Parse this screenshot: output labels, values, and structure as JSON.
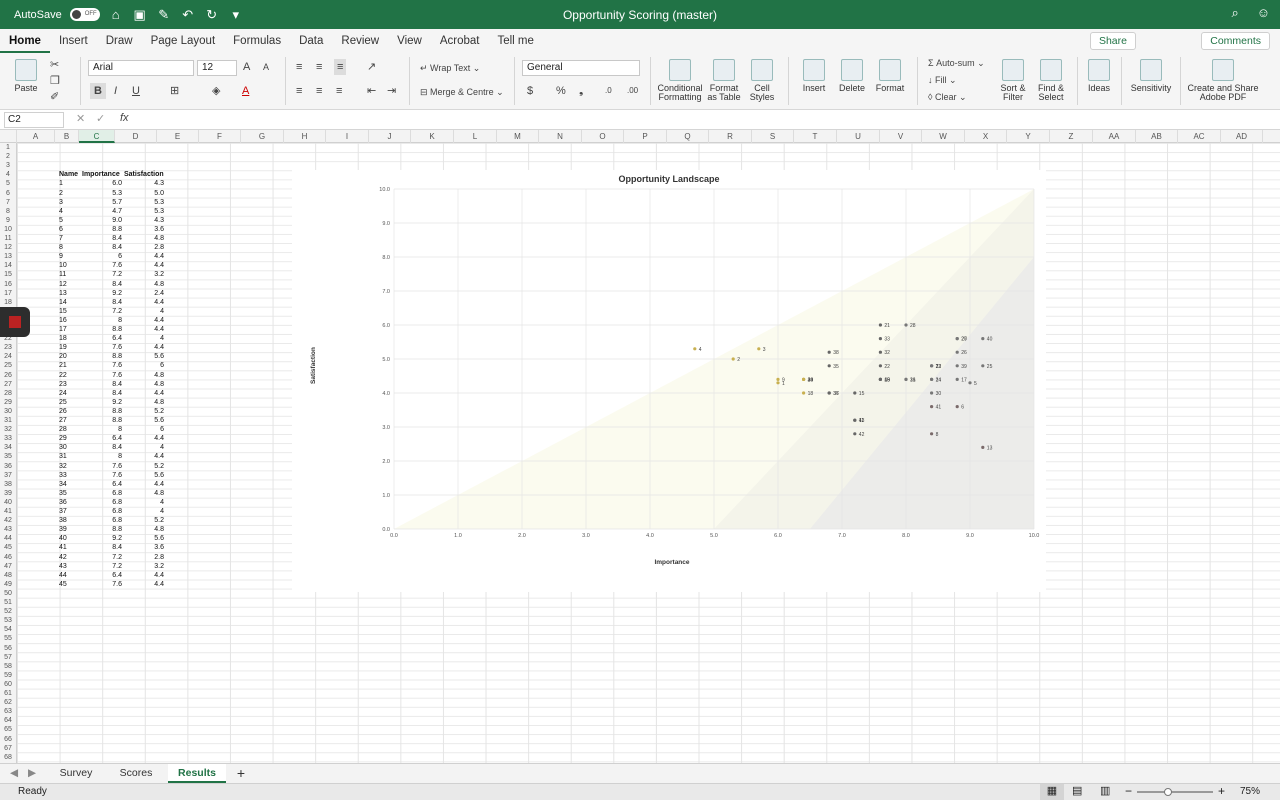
{
  "title_bar": {
    "autosave_label": "AutoSave",
    "autosave_state": "OFF",
    "doc_title": "Opportunity Scoring (master)"
  },
  "ribbon_tabs": [
    "Home",
    "Insert",
    "Draw",
    "Page Layout",
    "Formulas",
    "Data",
    "Review",
    "View",
    "Acrobat",
    "Tell me"
  ],
  "share_label": "Share",
  "comments_label": "Comments",
  "ribbon": {
    "paste": "Paste",
    "font_name": "Arial",
    "font_size": "12",
    "wrap_text": "Wrap Text",
    "merge_centre": "Merge & Centre",
    "number_format": "General",
    "conditional": [
      "Conditional",
      "Formatting"
    ],
    "format_table": [
      "Format",
      "as Table"
    ],
    "cell_styles": [
      "Cell",
      "Styles"
    ],
    "insert": "Insert",
    "delete": "Delete",
    "format": "Format",
    "autosum": "Auto-sum",
    "fill": "Fill",
    "clear": "Clear",
    "sort_filter": [
      "Sort &",
      "Filter"
    ],
    "find_select": [
      "Find &",
      "Select"
    ],
    "ideas": "Ideas",
    "sensitivity": "Sensitivity",
    "adobe": [
      "Create and Share",
      "Adobe PDF"
    ]
  },
  "formula_bar": {
    "name_box": "C2",
    "fx": "fx",
    "formula": ""
  },
  "columns": [
    "A",
    "B",
    "C",
    "D",
    "E",
    "F",
    "G",
    "H",
    "I",
    "J",
    "K",
    "L",
    "M",
    "N",
    "O",
    "P",
    "Q",
    "R",
    "S",
    "T",
    "U",
    "V",
    "W",
    "X",
    "Y",
    "Z",
    "AA",
    "AB",
    "AC",
    "AD"
  ],
  "table": {
    "headers": [
      "Name",
      "Importance",
      "Satisfaction"
    ],
    "rows": [
      [
        "1",
        "6.0",
        "4.3"
      ],
      [
        "2",
        "5.3",
        "5.0"
      ],
      [
        "3",
        "5.7",
        "5.3"
      ],
      [
        "4",
        "4.7",
        "5.3"
      ],
      [
        "5",
        "9.0",
        "4.3"
      ],
      [
        "6",
        "8.8",
        "3.6"
      ],
      [
        "7",
        "8.4",
        "4.8"
      ],
      [
        "8",
        "8.4",
        "2.8"
      ],
      [
        "9",
        "6",
        "4.4"
      ],
      [
        "10",
        "7.6",
        "4.4"
      ],
      [
        "11",
        "7.2",
        "3.2"
      ],
      [
        "12",
        "8.4",
        "4.8"
      ],
      [
        "13",
        "9.2",
        "2.4"
      ],
      [
        "14",
        "8.4",
        "4.4"
      ],
      [
        "15",
        "7.2",
        "4"
      ],
      [
        "16",
        "8",
        "4.4"
      ],
      [
        "17",
        "8.8",
        "4.4"
      ],
      [
        "18",
        "6.4",
        "4"
      ],
      [
        "19",
        "7.6",
        "4.4"
      ],
      [
        "20",
        "8.8",
        "5.6"
      ],
      [
        "21",
        "7.6",
        "6"
      ],
      [
        "22",
        "7.6",
        "4.8"
      ],
      [
        "23",
        "8.4",
        "4.8"
      ],
      [
        "24",
        "8.4",
        "4.4"
      ],
      [
        "25",
        "9.2",
        "4.8"
      ],
      [
        "26",
        "8.8",
        "5.2"
      ],
      [
        "27",
        "8.8",
        "5.6"
      ],
      [
        "28",
        "8",
        "6"
      ],
      [
        "29",
        "6.4",
        "4.4"
      ],
      [
        "30",
        "8.4",
        "4"
      ],
      [
        "31",
        "8",
        "4.4"
      ],
      [
        "32",
        "7.6",
        "5.2"
      ],
      [
        "33",
        "7.6",
        "5.6"
      ],
      [
        "34",
        "6.4",
        "4.4"
      ],
      [
        "35",
        "6.8",
        "4.8"
      ],
      [
        "36",
        "6.8",
        "4"
      ],
      [
        "37",
        "6.8",
        "4"
      ],
      [
        "38",
        "6.8",
        "5.2"
      ],
      [
        "39",
        "8.8",
        "4.8"
      ],
      [
        "40",
        "9.2",
        "5.6"
      ],
      [
        "41",
        "8.4",
        "3.6"
      ],
      [
        "42",
        "7.2",
        "2.8"
      ],
      [
        "43",
        "7.2",
        "3.2"
      ],
      [
        "44",
        "6.4",
        "4.4"
      ],
      [
        "45",
        "7.6",
        "4.4"
      ]
    ]
  },
  "chart_data": {
    "type": "scatter",
    "title": "Opportunity Landscape",
    "xlabel": "Importance",
    "ylabel": "Satisfaction",
    "xlim": [
      0,
      10
    ],
    "ylim": [
      0,
      10
    ],
    "xticks": [
      "0.0",
      "1.0",
      "2.0",
      "3.0",
      "4.0",
      "5.0",
      "6.0",
      "7.0",
      "8.0",
      "9.0",
      "10.0"
    ],
    "yticks": [
      "0.0",
      "1.0",
      "2.0",
      "3.0",
      "4.0",
      "5.0",
      "6.0",
      "7.0",
      "8.0",
      "9.0",
      "10.0"
    ],
    "points": [
      {
        "label": "1",
        "x": 6.0,
        "y": 4.3
      },
      {
        "label": "2",
        "x": 5.3,
        "y": 5.0
      },
      {
        "label": "3",
        "x": 5.7,
        "y": 5.3
      },
      {
        "label": "4",
        "x": 4.7,
        "y": 5.3
      },
      {
        "label": "5",
        "x": 9.0,
        "y": 4.3
      },
      {
        "label": "6",
        "x": 8.8,
        "y": 3.6
      },
      {
        "label": "7",
        "x": 8.4,
        "y": 4.8
      },
      {
        "label": "8",
        "x": 8.4,
        "y": 2.8
      },
      {
        "label": "9",
        "x": 6,
        "y": 4.4
      },
      {
        "label": "10",
        "x": 7.6,
        "y": 4.4
      },
      {
        "label": "11",
        "x": 7.2,
        "y": 3.2
      },
      {
        "label": "12",
        "x": 8.4,
        "y": 4.8
      },
      {
        "label": "13",
        "x": 9.2,
        "y": 2.4
      },
      {
        "label": "14",
        "x": 8.4,
        "y": 4.4
      },
      {
        "label": "15",
        "x": 7.2,
        "y": 4
      },
      {
        "label": "16",
        "x": 8,
        "y": 4.4
      },
      {
        "label": "17",
        "x": 8.8,
        "y": 4.4
      },
      {
        "label": "18",
        "x": 6.4,
        "y": 4
      },
      {
        "label": "19",
        "x": 7.6,
        "y": 4.4
      },
      {
        "label": "20",
        "x": 8.8,
        "y": 5.6
      },
      {
        "label": "21",
        "x": 7.6,
        "y": 6
      },
      {
        "label": "22",
        "x": 7.6,
        "y": 4.8
      },
      {
        "label": "23",
        "x": 8.4,
        "y": 4.8
      },
      {
        "label": "24",
        "x": 8.4,
        "y": 4.4
      },
      {
        "label": "25",
        "x": 9.2,
        "y": 4.8
      },
      {
        "label": "26",
        "x": 8.8,
        "y": 5.2
      },
      {
        "label": "27",
        "x": 8.8,
        "y": 5.6
      },
      {
        "label": "28",
        "x": 8,
        "y": 6
      },
      {
        "label": "29",
        "x": 6.4,
        "y": 4.4
      },
      {
        "label": "30",
        "x": 8.4,
        "y": 4
      },
      {
        "label": "31",
        "x": 8,
        "y": 4.4
      },
      {
        "label": "32",
        "x": 7.6,
        "y": 5.2
      },
      {
        "label": "33",
        "x": 7.6,
        "y": 5.6
      },
      {
        "label": "34",
        "x": 6.4,
        "y": 4.4
      },
      {
        "label": "35",
        "x": 6.8,
        "y": 4.8
      },
      {
        "label": "36",
        "x": 6.8,
        "y": 4
      },
      {
        "label": "37",
        "x": 6.8,
        "y": 4
      },
      {
        "label": "38",
        "x": 6.8,
        "y": 5.2
      },
      {
        "label": "39",
        "x": 8.8,
        "y": 4.8
      },
      {
        "label": "40",
        "x": 9.2,
        "y": 5.6
      },
      {
        "label": "41",
        "x": 8.4,
        "y": 3.6
      },
      {
        "label": "42",
        "x": 7.2,
        "y": 2.8
      },
      {
        "label": "43",
        "x": 7.2,
        "y": 3.2
      },
      {
        "label": "44",
        "x": 6.4,
        "y": 4.4
      },
      {
        "label": "45",
        "x": 7.6,
        "y": 4.4
      }
    ],
    "grid": true,
    "legend": "none"
  },
  "sheet_tabs": [
    "Survey",
    "Scores",
    "Results"
  ],
  "active_sheet": "Results",
  "status": {
    "ready": "Ready",
    "zoom": "75%"
  }
}
